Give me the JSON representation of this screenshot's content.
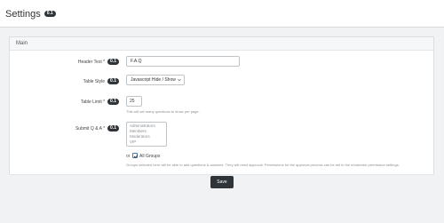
{
  "page": {
    "title": "Settings",
    "title_badge": "0.1"
  },
  "section": {
    "heading": "Main"
  },
  "fields": {
    "header_text": {
      "label": "Header Text *",
      "badge": "0.1",
      "value": "F.A.Q"
    },
    "table_style": {
      "label": "Table Style",
      "badge": "0.1",
      "selected": "Javascript Hide / Show"
    },
    "table_limit": {
      "label": "Table Limit *",
      "badge": "0.1",
      "value": "25",
      "hint": "This will set many questions to show per page."
    },
    "submit_qa": {
      "label": "Submit Q & A *",
      "badge": "0.1",
      "options": [
        "Administrators",
        "Members",
        "Moderators",
        "VIP"
      ],
      "or_text": "or",
      "all_groups_label": "All Groups",
      "all_groups_checked": true,
      "hint": "Groups selected here will be able to add questions & answers. They will need approval. Permissions for the approval process can be set in the moderator permission settings."
    }
  },
  "actions": {
    "save_label": "Save"
  },
  "colors": {
    "badge_bg": "#2f3438",
    "button_bg": "#2f3438",
    "checkbox_accent": "#4a7ab6"
  }
}
